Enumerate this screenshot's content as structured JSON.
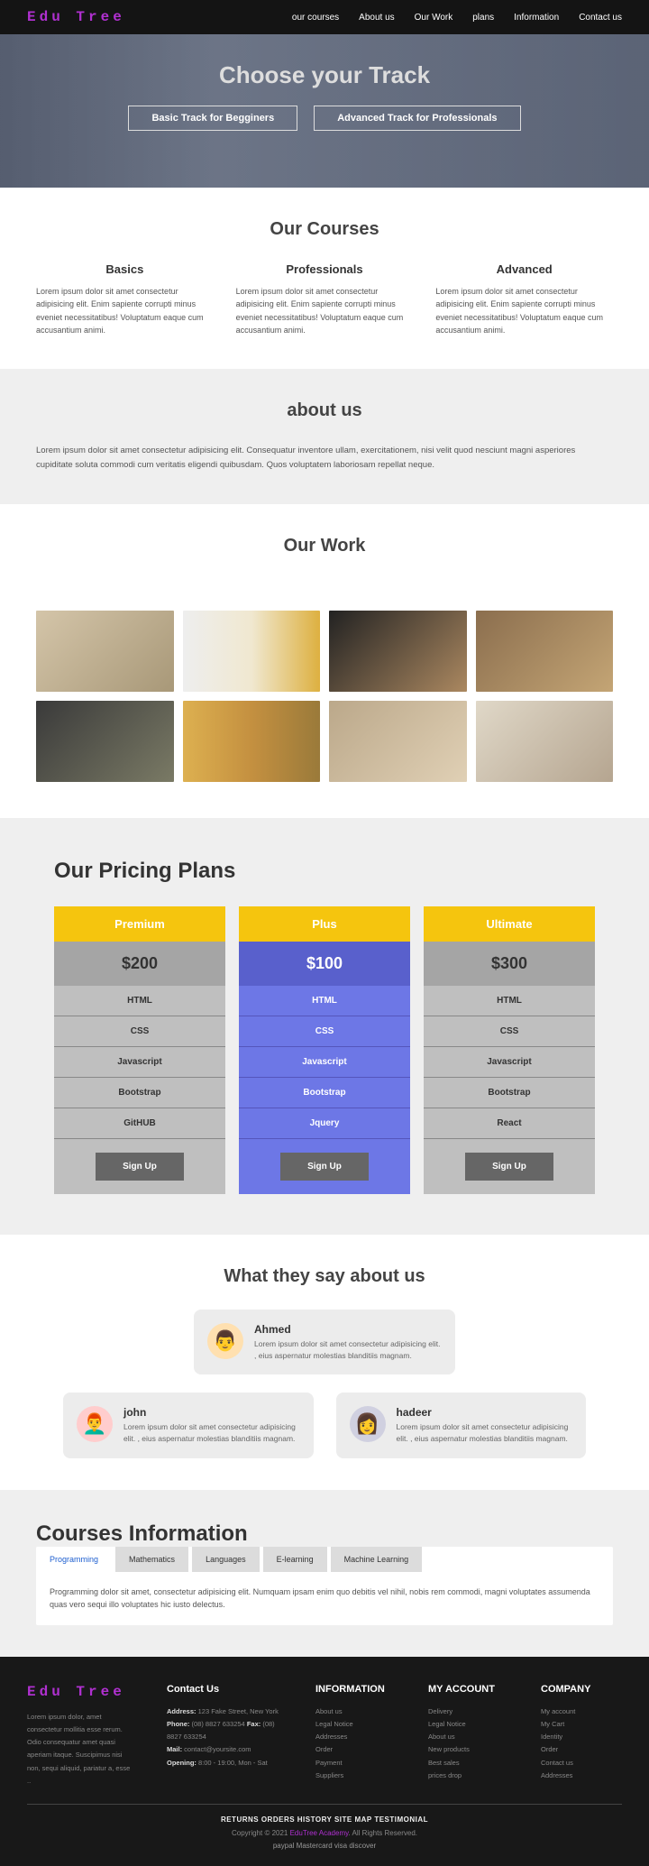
{
  "nav": {
    "logo": "Edu Tree",
    "links": [
      "our courses",
      "About us",
      "Our Work",
      "plans",
      "Information",
      "Contact us"
    ]
  },
  "hero": {
    "title": "Choose your Track",
    "btn1": "Basic Track for Begginers",
    "btn2": "Advanced Track for Professionals"
  },
  "courses": {
    "title": "Our Courses",
    "items": [
      {
        "name": "Basics",
        "desc": "Lorem ipsum dolor sit amet consectetur adipisicing elit. Enim sapiente corrupti minus eveniet necessitatibus! Voluptatum eaque cum accusantium animi."
      },
      {
        "name": "Professionals",
        "desc": "Lorem ipsum dolor sit amet consectetur adipisicing elit. Enim sapiente corrupti minus eveniet necessitatibus! Voluptatum eaque cum accusantium animi."
      },
      {
        "name": "Advanced",
        "desc": "Lorem ipsum dolor sit amet consectetur adipisicing elit. Enim sapiente corrupti minus eveniet necessitatibus! Voluptatum eaque cum accusantium animi."
      }
    ]
  },
  "about": {
    "title": "about us",
    "text": "Lorem ipsum dolor sit amet consectetur adipisicing elit. Consequatur inventore ullam, exercitationem, nisi velit quod nesciunt magni asperiores cupiditate soluta commodi cum veritatis eligendi quibusdam. Quos voluptatem laboriosam repellat neque."
  },
  "work": {
    "title": "Our Work"
  },
  "pricing": {
    "title": "Our Pricing Plans",
    "plans": [
      {
        "name": "Premium",
        "price": "$200",
        "items": [
          "HTML",
          "CSS",
          "Javascript",
          "Bootstrap",
          "GitHUB"
        ],
        "btn": "Sign Up"
      },
      {
        "name": "Plus",
        "price": "$100",
        "items": [
          "HTML",
          "CSS",
          "Javascript",
          "Bootstrap",
          "Jquery"
        ],
        "btn": "Sign Up"
      },
      {
        "name": "Ultimate",
        "price": "$300",
        "items": [
          "HTML",
          "CSS",
          "Javascript",
          "Bootstrap",
          "React"
        ],
        "btn": "Sign Up"
      }
    ]
  },
  "testimonials": {
    "title": "What they say about us",
    "items": [
      {
        "name": "Ahmed",
        "text": "Lorem ipsum dolor sit amet consectetur adipisicing elit. , eius aspernatur molestias blanditiis magnam."
      },
      {
        "name": "john",
        "text": "Lorem ipsum dolor sit amet consectetur adipisicing elit. , eius aspernatur molestias blanditiis magnam."
      },
      {
        "name": "hadeer",
        "text": "Lorem ipsum dolor sit amet consectetur adipisicing elit. , eius aspernatur molestias blanditiis magnam."
      }
    ]
  },
  "info": {
    "title": "Courses Information",
    "tabs": [
      "Programming",
      "Mathematics",
      "Languages",
      "E-learning",
      "Machine Learning"
    ],
    "content": "Programming dolor sit amet, consectetur adipisicing elit. Numquam ipsam enim quo debitis vel nihil, nobis rem commodi, magni voluptates assumenda quas vero sequi illo voluptates hic iusto delectus."
  },
  "footer": {
    "logo": "Edu Tree",
    "desc": "Lorem ipsum dolor, amet consectetur mollitia esse rerum. Odio consequatur amet quasi aperiam itaque. Suscipimus nisi non, sequi aliquid, pariatur a, esse ..",
    "contact": {
      "title": "Contact Us",
      "address_lbl": "Address:",
      "address": " 123 Fake Street, New York",
      "phone_lbl": "Phone:",
      "phone": " (08) 8827 633254 ",
      "fax_lbl": "Fax:",
      "fax": " (08) 8827 633254",
      "mail_lbl": "Mail:",
      "mail": " contact@yoursite.com",
      "opening_lbl": "Opening:",
      "opening": " 8:00 - 19:00, Mon - Sat"
    },
    "cols": [
      {
        "title": "INFORMATION",
        "links": [
          "About us",
          "Legal Notice",
          "Addresses",
          "Order",
          "Payment",
          "Suppliers"
        ]
      },
      {
        "title": "MY ACCOUNT",
        "links": [
          "Delivery",
          "Legal Notice",
          "About us",
          "New products",
          "Best sales",
          "prices drop"
        ]
      },
      {
        "title": "COMPANY",
        "links": [
          "My account",
          "My Cart",
          "Identity",
          "Order",
          "Contact us",
          "Addresses"
        ]
      }
    ],
    "bottomLinks": "RETURNS   ORDERS HISTORY   SITE MAP   TESTIMONIAL",
    "copy1": "Copyright © 2021 ",
    "copyBrand": "EduTree Academy",
    "copy2": ". All Rights Reserved.",
    "payments": "paypal Mastercard visa discover"
  }
}
